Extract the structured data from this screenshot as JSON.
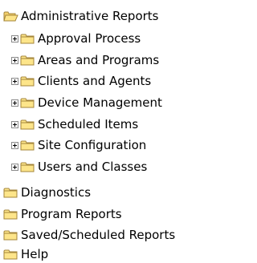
{
  "tree": {
    "root": {
      "label": "Administrative Reports",
      "icon": "folder-open-icon",
      "children": [
        {
          "label": "Approval Process",
          "icon": "folder-icon"
        },
        {
          "label": "Areas and Programs",
          "icon": "folder-icon"
        },
        {
          "label": "Clients and Agents",
          "icon": "folder-icon"
        },
        {
          "label": "Device Management",
          "icon": "folder-icon"
        },
        {
          "label": "Scheduled Items",
          "icon": "folder-icon"
        },
        {
          "label": "Site Configuration",
          "icon": "folder-icon"
        },
        {
          "label": "Users and Classes",
          "icon": "folder-icon"
        }
      ]
    },
    "siblings": [
      {
        "label": "Diagnostics",
        "icon": "folder-icon"
      },
      {
        "label": "Program Reports",
        "icon": "folder-icon"
      },
      {
        "label": "Saved/Scheduled Reports",
        "icon": "folder-icon"
      },
      {
        "label": "Help",
        "icon": "folder-icon"
      }
    ]
  },
  "colors": {
    "folder_fill": "#fde58a",
    "folder_stroke": "#a4853a",
    "text": "#000000",
    "background": "#ffffff"
  }
}
